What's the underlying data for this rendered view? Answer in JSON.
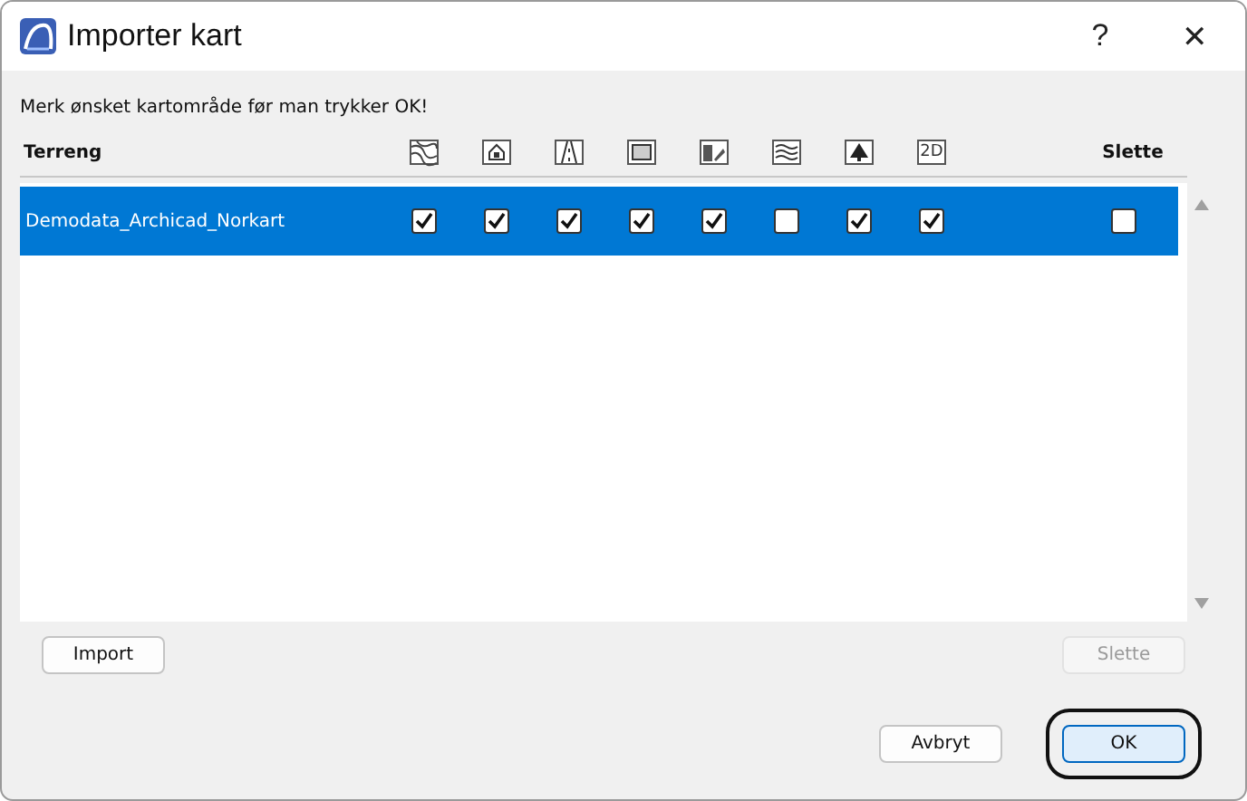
{
  "window": {
    "title": "Importer kart",
    "help": "?",
    "close": "✕"
  },
  "instruction": "Merk ønsket kartområde før man trykker OK!",
  "table": {
    "name_header": "Terreng",
    "delete_header": "Slette",
    "layer_columns": [
      {
        "kind": "terrain"
      },
      {
        "kind": "building"
      },
      {
        "kind": "road"
      },
      {
        "kind": "wall"
      },
      {
        "kind": "property"
      },
      {
        "kind": "water"
      },
      {
        "kind": "tree"
      },
      {
        "kind": "text",
        "label": "2D"
      }
    ],
    "rows": [
      {
        "name": "Demodata_Archicad_Norkart",
        "selected": true,
        "layers": [
          {
            "checked": true
          },
          {
            "checked": true
          },
          {
            "checked": true
          },
          {
            "checked": true
          },
          {
            "checked": true
          },
          {
            "checked": false
          },
          {
            "checked": true
          },
          {
            "checked": true
          }
        ],
        "delete": {
          "checked": false
        }
      }
    ]
  },
  "buttons": {
    "import": {
      "label": "Import",
      "disabled": false
    },
    "delete": {
      "label": "Slette",
      "disabled": true
    },
    "cancel": {
      "label": "Avbryt",
      "focused": false
    },
    "ok": {
      "label": "OK",
      "focused": true
    }
  }
}
